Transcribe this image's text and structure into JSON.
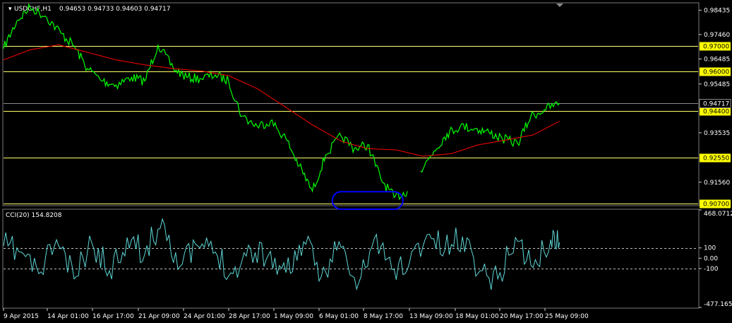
{
  "chart_data": [
    {
      "type": "line",
      "title": "USDCHF,H1",
      "ohlc_text": "0.94653 0.94733 0.94603 0.94717",
      "price_ticks": [
        "0.98435",
        "0.97460",
        "0.96485",
        "0.95485",
        "0.93535",
        "0.91560"
      ],
      "price_tick_values": [
        0.98435,
        0.9746,
        0.96485,
        0.95485,
        0.93535,
        0.9156
      ],
      "ylim": [
        0.9065,
        0.987
      ],
      "current_price": {
        "label": "0.94717",
        "value": 0.94717
      },
      "levels": [
        {
          "label": "0.97000",
          "value": 0.97
        },
        {
          "label": "0.96000",
          "value": 0.96
        },
        {
          "label": "0.94400",
          "value": 0.944
        },
        {
          "label": "0.92550",
          "value": 0.9255
        },
        {
          "label": "0.90700",
          "value": 0.907
        }
      ],
      "x_labels": [
        "9 Apr 2015",
        "14 Apr 01:00",
        "16 Apr 17:00",
        "21 Apr 09:00",
        "24 Apr 01:00",
        "28 Apr 17:00",
        "1 May 09:00",
        "6 May 01:00",
        "8 May 17:00",
        "13 May 09:00",
        "18 May 01:00",
        "20 May 17:00",
        "25 May 09:00"
      ],
      "series": [
        {
          "name": "",
          "color": "#00ff00",
          "x_index": [
            0,
            6,
            12,
            19,
            26,
            32,
            38,
            45,
            51,
            58,
            64,
            70,
            77,
            83,
            89,
            96,
            102,
            108,
            115,
            121,
            128,
            134,
            140,
            146,
            153,
            159,
            165,
            171,
            177,
            183
          ],
          "values": [
            0.969,
            0.98,
            0.9855,
            0.982,
            0.9752,
            0.97,
            0.961,
            0.956,
            0.9545,
            0.9575,
            0.956,
            0.9705,
            0.961,
            0.9575,
            0.957,
            0.9585,
            0.956,
            0.942,
            0.938,
            0.94,
            0.933,
            0.922,
            0.912,
            0.9265,
            0.934,
            0.929,
            0.9305,
            0.917,
            0.9095,
            0.912
          ]
        },
        {
          "name": "",
          "color": "#00ff00",
          "x_index": [
            189,
            195,
            201,
            207,
            214,
            220,
            226,
            233,
            239,
            245,
            252
          ],
          "values": [
            0.92,
            0.928,
            0.935,
            0.938,
            0.937,
            0.9355,
            0.933,
            0.931,
            0.942,
            0.9445,
            0.9472
          ]
        },
        {
          "name": "",
          "color": "#ff0000",
          "x_index": [
            0,
            12,
            25,
            38,
            51,
            64,
            77,
            90,
            102,
            115,
            128,
            140,
            153,
            165,
            178,
            190,
            203,
            215,
            228,
            240,
            252
          ],
          "values": [
            0.9645,
            0.9685,
            0.9705,
            0.9675,
            0.9645,
            0.9625,
            0.961,
            0.96,
            0.9582,
            0.953,
            0.9455,
            0.9385,
            0.932,
            0.929,
            0.9285,
            0.926,
            0.927,
            0.9305,
            0.9325,
            0.9345,
            0.94
          ]
        }
      ],
      "annotations": [
        {
          "type": "ellipse",
          "color": "#0000ff",
          "x_range": [
            149,
            181
          ],
          "y_range": [
            0.9048,
            0.9118
          ]
        }
      ],
      "grid": false,
      "legend": "none"
    },
    {
      "type": "line",
      "title": "CCI(20) 154.8208",
      "ticks": [
        "468.0712",
        "100",
        "0.00",
        "-100",
        "-477.1659"
      ],
      "tick_values": [
        468.0712,
        100,
        0,
        -100,
        -477.1659
      ],
      "ylim": [
        -477.1659,
        468.0712
      ],
      "reference_levels": [
        100,
        -100
      ],
      "series": [
        {
          "name": "",
          "color": "#5fd7d7",
          "x_index": [
            0,
            8,
            16,
            24,
            32,
            40,
            48,
            56,
            64,
            72,
            80,
            88,
            96,
            104,
            112,
            120,
            128,
            136,
            144,
            152,
            160,
            168,
            176,
            184,
            192,
            200,
            208,
            216,
            224,
            232,
            240,
            248,
            252
          ],
          "values": [
            120,
            60,
            -150,
            180,
            -200,
            150,
            -120,
            200,
            40,
            380,
            -80,
            120,
            60,
            -150,
            90,
            30,
            -140,
            160,
            -180,
            160,
            -300,
            190,
            -110,
            -40,
            230,
            80,
            210,
            -120,
            -200,
            200,
            -90,
            180,
            155
          ]
        }
      ],
      "grid": false,
      "legend": "none"
    }
  ]
}
